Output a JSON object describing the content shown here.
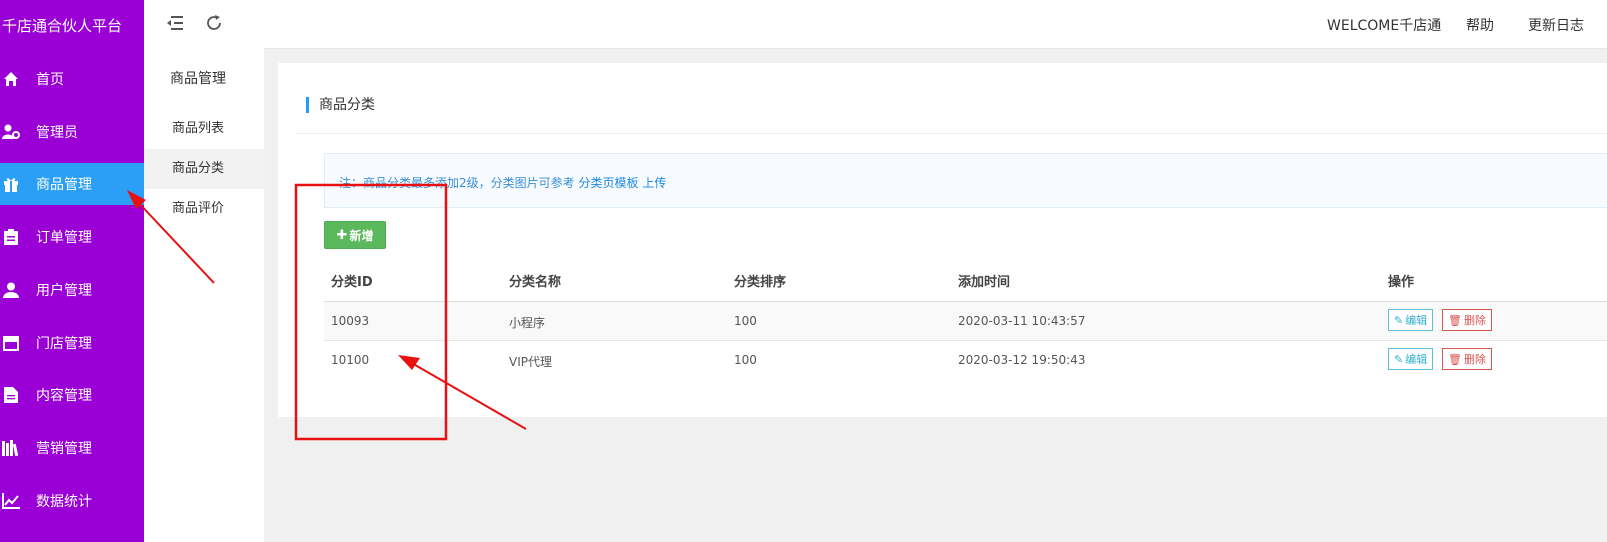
{
  "brand": "千店通合伙人平台",
  "sidebar": {
    "items": [
      {
        "label": "首页",
        "icon": "home-icon"
      },
      {
        "label": "管理员",
        "icon": "admin-user-icon"
      },
      {
        "label": "商品管理",
        "icon": "gift-icon",
        "active": true
      },
      {
        "label": "订单管理",
        "icon": "clipboard-icon"
      },
      {
        "label": "用户管理",
        "icon": "user-icon"
      },
      {
        "label": "门店管理",
        "icon": "store-icon"
      },
      {
        "label": "内容管理",
        "icon": "document-icon"
      },
      {
        "label": "营销管理",
        "icon": "books-icon"
      },
      {
        "label": "数据统计",
        "icon": "line-chart-icon"
      }
    ]
  },
  "subnav": {
    "title": "商品管理",
    "items": [
      {
        "label": "商品列表"
      },
      {
        "label": "商品分类",
        "active": true
      },
      {
        "label": "商品评价"
      }
    ]
  },
  "topbar": {
    "welcome": "WELCOME千店通",
    "help": "帮助",
    "changelog": "更新日志"
  },
  "panel": {
    "title": "商品分类",
    "note_prefix": "注：商品分类最多添加2级，分类图片可参考",
    "note_link": "分类页模板",
    "note_link2": "上传",
    "add_button": "新增"
  },
  "table": {
    "columns": [
      "分类ID",
      "分类名称",
      "分类排序",
      "添加时间",
      "操作"
    ],
    "rows": [
      {
        "id": "10093",
        "name": "小程序",
        "sort": "100",
        "time": "2020-03-11 10:43:57"
      },
      {
        "id": "10100",
        "name": "VIP代理",
        "sort": "100",
        "time": "2020-03-12 19:50:43"
      }
    ],
    "edit_label": "编辑",
    "delete_label": "删除"
  },
  "colors": {
    "sidebar": "#9a00d5",
    "active_nav": "#2a9ff5",
    "add_button": "#5cb85c",
    "annotation": "#e81010"
  }
}
